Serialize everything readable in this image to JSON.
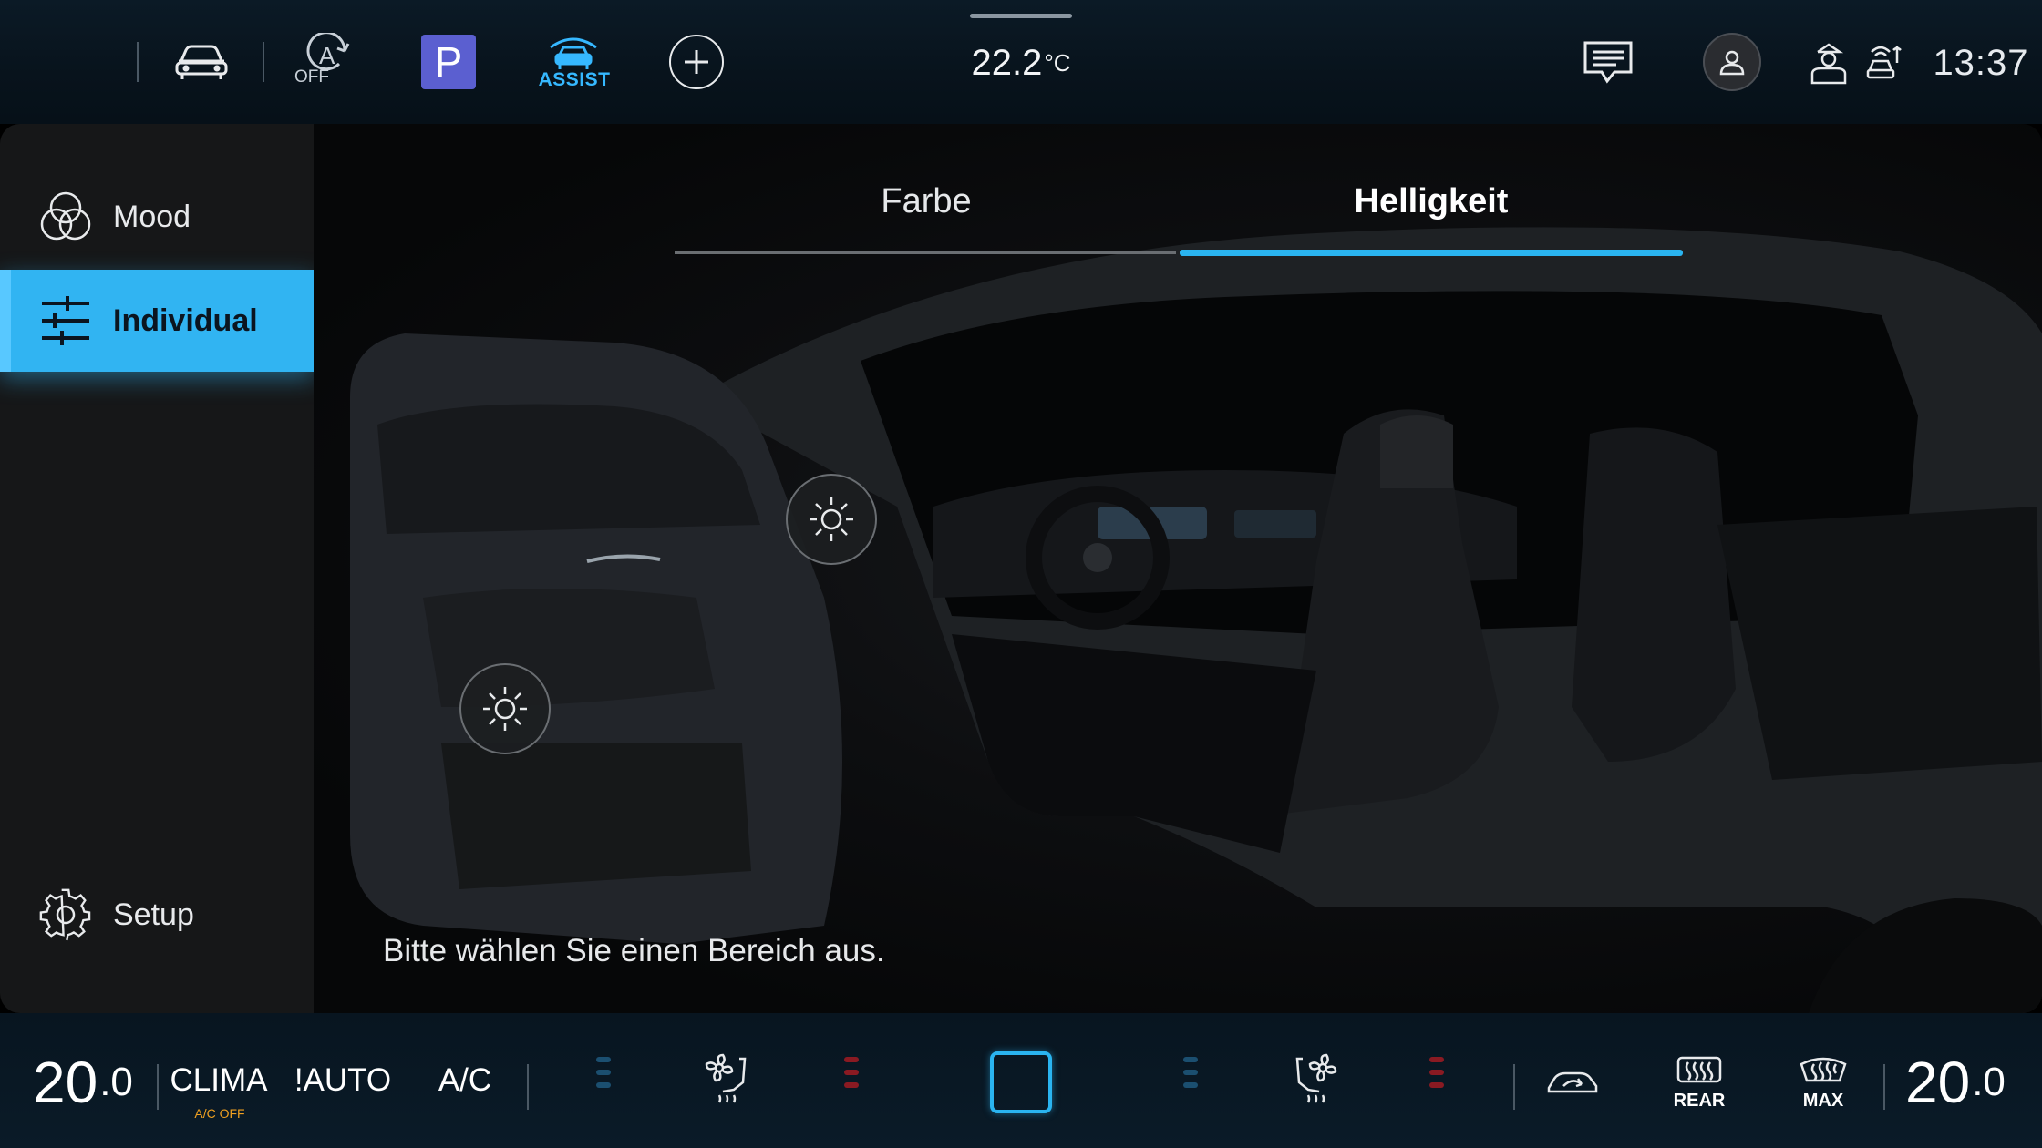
{
  "topbar": {
    "auto_hold_off_label": "OFF",
    "parking_label": "P",
    "assist_label": "ASSIST",
    "outside_temp_value": "22.2",
    "outside_temp_unit": "°C",
    "clock": "13:37"
  },
  "sidebar": {
    "items": [
      {
        "label": "Mood",
        "icon": "circles-icon"
      },
      {
        "label": "Individual",
        "icon": "sliders-icon"
      },
      {
        "label": "Setup",
        "icon": "gear-icon"
      }
    ],
    "selected": "Individual"
  },
  "content": {
    "tabs": [
      {
        "label": "Farbe"
      },
      {
        "label": "Helligkeit"
      }
    ],
    "active_tab": "Helligkeit",
    "hint": "Bitte wählen Sie einen Bereich aus."
  },
  "climate": {
    "temp_left_int": "20",
    "temp_left_dec": ".0",
    "temp_right_int": "20",
    "temp_right_dec": ".0",
    "clima_label": "CLIMA",
    "ac_off_label": "A/C OFF",
    "auto_label": "!AUTO",
    "ac_label": "A/C",
    "rear_label": "REAR",
    "max_label": "MAX"
  },
  "colors": {
    "accent": "#2ab4f0",
    "selected_item": "#31b4f2",
    "parking": "#5b5fd0",
    "heat": "#8a1a22",
    "cool": "#1b4f70",
    "warning": "#f0a020"
  }
}
